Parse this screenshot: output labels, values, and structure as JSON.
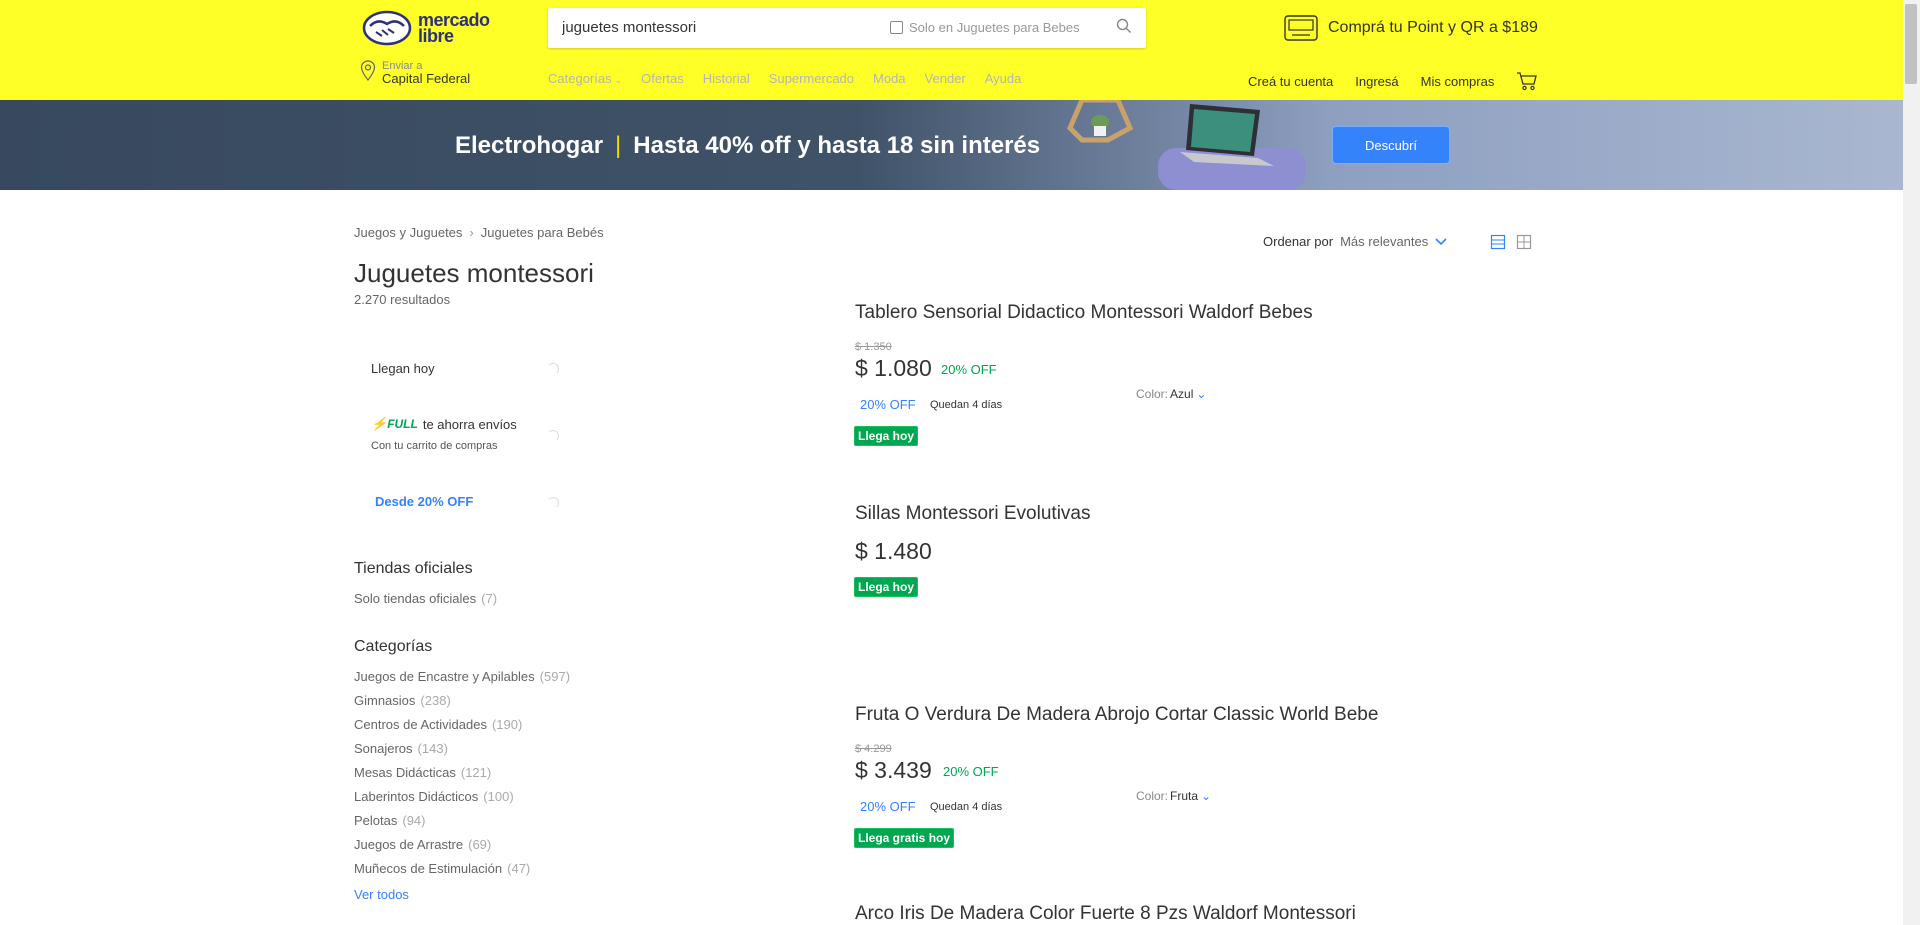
{
  "header": {
    "logo_line1": "mercado",
    "logo_line2": "libre",
    "search_value": "juguetes montessori",
    "search_scope": "Solo en Juguetes para Bebes",
    "promo": "Comprá tu Point y QR a $189",
    "location_label": "Enviar a",
    "location_value": "Capital Federal",
    "nav": [
      "Categorías",
      "Ofertas",
      "Historial",
      "Supermercado",
      "Moda",
      "Vender",
      "Ayuda"
    ],
    "user_nav": [
      "Creá tu cuenta",
      "Ingresá",
      "Mis compras"
    ]
  },
  "banner": {
    "category": "Electrohogar",
    "separator": "|",
    "message": "Hasta 40% off y hasta 18 sin interés",
    "button": "Descubrí"
  },
  "breadcrumb": [
    "Juegos y Juguetes",
    "Juguetes para Bebés"
  ],
  "page_title": "Juguetes montessori",
  "results": "2.270 resultados",
  "sort": {
    "label": "Ordenar por",
    "value": "Más relevantes"
  },
  "filters": {
    "llegan_hoy": "Llegan hoy",
    "full_badge": "FULL",
    "full_text": "te ahorra envíos",
    "full_sub": "Con tu carrito de compras",
    "desde": "Desde 20% OFF"
  },
  "tiendas": {
    "title": "Tiendas oficiales",
    "label": "Solo tiendas oficiales",
    "count": "(7)"
  },
  "categorias": {
    "title": "Categorías",
    "items": [
      {
        "label": "Juegos de Encastre y Apilables",
        "count": "(597)"
      },
      {
        "label": "Gimnasios",
        "count": "(238)"
      },
      {
        "label": "Centros de Actividades",
        "count": "(190)"
      },
      {
        "label": "Sonajeros",
        "count": "(143)"
      },
      {
        "label": "Mesas Didácticas",
        "count": "(121)"
      },
      {
        "label": "Laberintos Didácticos",
        "count": "(100)"
      },
      {
        "label": "Pelotas",
        "count": "(94)"
      },
      {
        "label": "Juegos de Arrastre",
        "count": "(69)"
      },
      {
        "label": "Muñecos de Estimulación",
        "count": "(47)"
      }
    ],
    "ver_todos": "Ver todos"
  },
  "items": [
    {
      "title": "Tablero Sensorial Didactico Montessori Waldorf Bebes",
      "old_price": "$ 1.350",
      "price": "$ 1.080",
      "off": "20% OFF",
      "chip": "20% OFF",
      "quedan": "Quedan 4 días",
      "tag": "Llega hoy",
      "color_label": "Color:",
      "color_value": "Azul"
    },
    {
      "title": "Sillas Montessori Evolutivas",
      "price": "$ 1.480",
      "tag": "Llega hoy"
    },
    {
      "title": "Fruta O Verdura De Madera Abrojo Cortar Classic World Bebe",
      "old_price": "$ 4.299",
      "price": "$ 3.439",
      "off": "20% OFF",
      "chip": "20% OFF",
      "quedan": "Quedan 4 días",
      "tag": "Llega gratis hoy",
      "color_label": "Color:",
      "color_value": "Fruta"
    },
    {
      "title": "Arco Iris De Madera Color Fuerte 8 Pzs Waldorf Montessori"
    }
  ],
  "colors": {
    "header": "#ffff28",
    "accent": "#3483fa",
    "green": "#00a650",
    "banner": "#3f5268"
  }
}
